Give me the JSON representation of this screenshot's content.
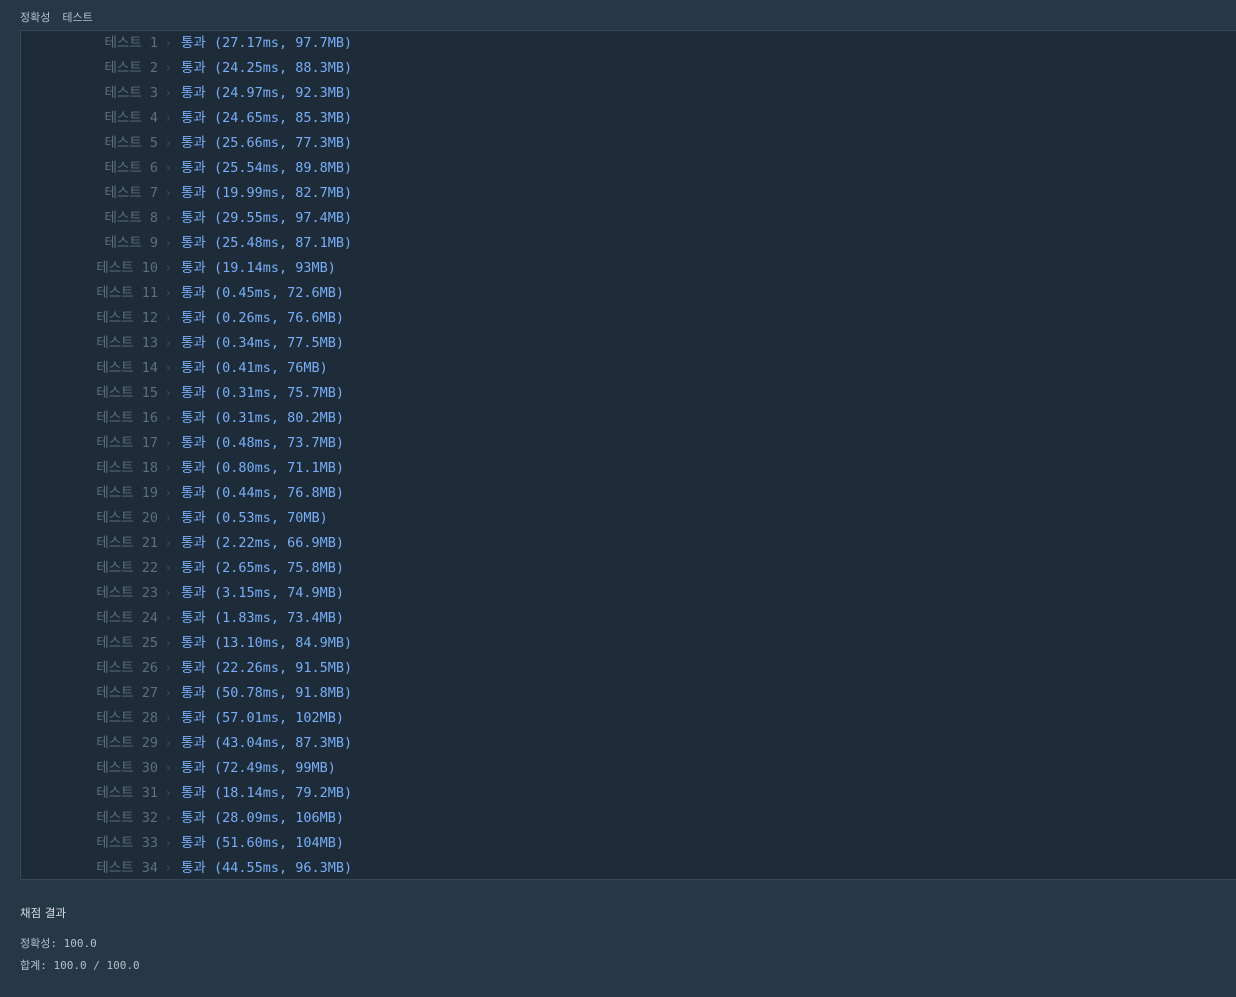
{
  "header": {
    "accuracy_label": "정확성",
    "test_label": "테스트"
  },
  "tests": [
    {
      "label": "테스트 1",
      "result": "통과 (27.17ms, 97.7MB)"
    },
    {
      "label": "테스트 2",
      "result": "통과 (24.25ms, 88.3MB)"
    },
    {
      "label": "테스트 3",
      "result": "통과 (24.97ms, 92.3MB)"
    },
    {
      "label": "테스트 4",
      "result": "통과 (24.65ms, 85.3MB)"
    },
    {
      "label": "테스트 5",
      "result": "통과 (25.66ms, 77.3MB)"
    },
    {
      "label": "테스트 6",
      "result": "통과 (25.54ms, 89.8MB)"
    },
    {
      "label": "테스트 7",
      "result": "통과 (19.99ms, 82.7MB)"
    },
    {
      "label": "테스트 8",
      "result": "통과 (29.55ms, 97.4MB)"
    },
    {
      "label": "테스트 9",
      "result": "통과 (25.48ms, 87.1MB)"
    },
    {
      "label": "테스트 10",
      "result": "통과 (19.14ms, 93MB)"
    },
    {
      "label": "테스트 11",
      "result": "통과 (0.45ms, 72.6MB)"
    },
    {
      "label": "테스트 12",
      "result": "통과 (0.26ms, 76.6MB)"
    },
    {
      "label": "테스트 13",
      "result": "통과 (0.34ms, 77.5MB)"
    },
    {
      "label": "테스트 14",
      "result": "통과 (0.41ms, 76MB)"
    },
    {
      "label": "테스트 15",
      "result": "통과 (0.31ms, 75.7MB)"
    },
    {
      "label": "테스트 16",
      "result": "통과 (0.31ms, 80.2MB)"
    },
    {
      "label": "테스트 17",
      "result": "통과 (0.48ms, 73.7MB)"
    },
    {
      "label": "테스트 18",
      "result": "통과 (0.80ms, 71.1MB)"
    },
    {
      "label": "테스트 19",
      "result": "통과 (0.44ms, 76.8MB)"
    },
    {
      "label": "테스트 20",
      "result": "통과 (0.53ms, 70MB)"
    },
    {
      "label": "테스트 21",
      "result": "통과 (2.22ms, 66.9MB)"
    },
    {
      "label": "테스트 22",
      "result": "통과 (2.65ms, 75.8MB)"
    },
    {
      "label": "테스트 23",
      "result": "통과 (3.15ms, 74.9MB)"
    },
    {
      "label": "테스트 24",
      "result": "통과 (1.83ms, 73.4MB)"
    },
    {
      "label": "테스트 25",
      "result": "통과 (13.10ms, 84.9MB)"
    },
    {
      "label": "테스트 26",
      "result": "통과 (22.26ms, 91.5MB)"
    },
    {
      "label": "테스트 27",
      "result": "통과 (50.78ms, 91.8MB)"
    },
    {
      "label": "테스트 28",
      "result": "통과 (57.01ms, 102MB)"
    },
    {
      "label": "테스트 29",
      "result": "통과 (43.04ms, 87.3MB)"
    },
    {
      "label": "테스트 30",
      "result": "통과 (72.49ms, 99MB)"
    },
    {
      "label": "테스트 31",
      "result": "통과 (18.14ms, 79.2MB)"
    },
    {
      "label": "테스트 32",
      "result": "통과 (28.09ms, 106MB)"
    },
    {
      "label": "테스트 33",
      "result": "통과 (51.60ms, 104MB)"
    },
    {
      "label": "테스트 34",
      "result": "통과 (44.55ms, 96.3MB)"
    }
  ],
  "summary": {
    "title": "채점 결과",
    "accuracy": "정확성: 100.0",
    "total": "합계: 100.0 / 100.0"
  },
  "icons": {
    "row_chevron": "chevron-right-icon"
  },
  "colors": {
    "pass": "#78aef7",
    "label": "#5d6f80",
    "background": "#263747",
    "panel": "#1e2b38"
  }
}
